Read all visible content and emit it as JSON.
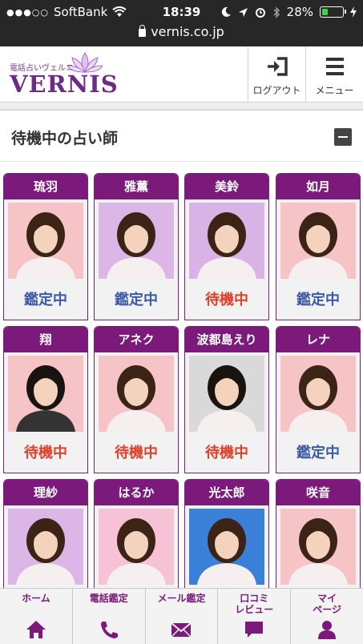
{
  "status_bar": {
    "carrier": "SoftBank",
    "time": "18:39",
    "battery": "28%",
    "battery_level": 0.28
  },
  "browser": {
    "url": "vernis.co.jp"
  },
  "header": {
    "logo_sub": "電話占いヴェルニ",
    "logo_main": "VERNIS",
    "logout_label": "ログアウト",
    "menu_label": "メニュー"
  },
  "section": {
    "title": "待機中の占い師"
  },
  "status_labels": {
    "busy": "鑑定中",
    "waiting": "待機中"
  },
  "colors": {
    "brand": "#7b1a7b",
    "busy": "#3d5aa8",
    "waiting": "#e2402b"
  },
  "fortune_tellers": [
    {
      "name": "琉羽",
      "status": "鑑定中",
      "state": "busy",
      "bg": "#f6c3c6"
    },
    {
      "name": "雅薫",
      "status": "鑑定中",
      "state": "busy",
      "bg": "#dcb6e6"
    },
    {
      "name": "美鈴",
      "status": "待機中",
      "state": "waiting",
      "bg": "#d9b3e6"
    },
    {
      "name": "如月",
      "status": "鑑定中",
      "state": "busy",
      "bg": "#f6c3c6"
    },
    {
      "name": "翔",
      "status": "待機中",
      "state": "waiting",
      "bg": "#f6c3c6"
    },
    {
      "name": "アネク",
      "status": "待機中",
      "state": "waiting",
      "bg": "#f6c3c6"
    },
    {
      "name": "波都島えり",
      "status": "待機中",
      "state": "waiting",
      "bg": "#d9d9d9"
    },
    {
      "name": "レナ",
      "status": "鑑定中",
      "state": "busy",
      "bg": "#f6c3c6"
    },
    {
      "name": "理紗",
      "status": "",
      "state": "",
      "bg": "#dcb6e6"
    },
    {
      "name": "はるか",
      "status": "",
      "state": "",
      "bg": "#f7c2d6"
    },
    {
      "name": "光太郎",
      "status": "",
      "state": "",
      "bg": "#3a7fd8"
    },
    {
      "name": "咲音",
      "status": "",
      "state": "",
      "bg": "#f6c3c6"
    }
  ],
  "tabs": [
    {
      "label": "ホーム",
      "icon": "home-icon"
    },
    {
      "label": "電話鑑定",
      "icon": "phone-icon"
    },
    {
      "label": "メール鑑定",
      "icon": "mail-icon"
    },
    {
      "label": "口コミ\nレビュー",
      "icon": "speech-bubble-icon"
    },
    {
      "label": "マイ\nページ",
      "icon": "person-icon"
    }
  ]
}
